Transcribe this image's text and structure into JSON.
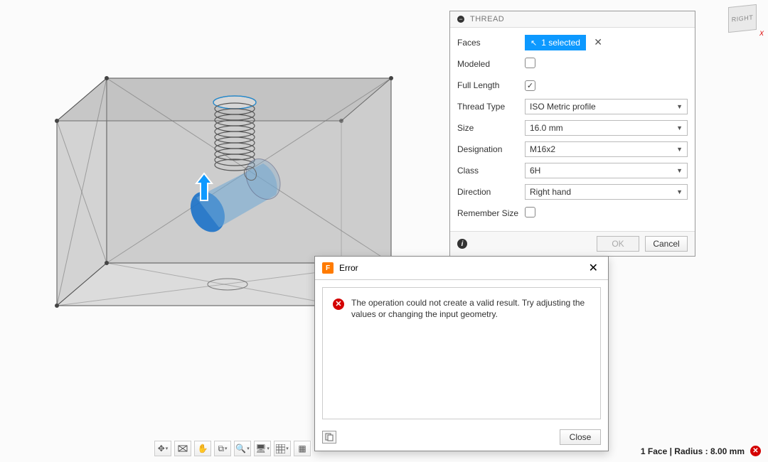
{
  "thread_panel": {
    "title": "THREAD",
    "rows": {
      "faces": {
        "label": "Faces",
        "chip_text": "1 selected"
      },
      "modeled": {
        "label": "Modeled",
        "checked": false
      },
      "full_length": {
        "label": "Full Length",
        "checked": true
      },
      "thread_type": {
        "label": "Thread Type",
        "value": "ISO Metric profile"
      },
      "size": {
        "label": "Size",
        "value": "16.0 mm"
      },
      "designation": {
        "label": "Designation",
        "value": "M16x2"
      },
      "class": {
        "label": "Class",
        "value": "6H"
      },
      "direction": {
        "label": "Direction",
        "value": "Right hand"
      },
      "remember": {
        "label": "Remember Size",
        "checked": false
      }
    },
    "buttons": {
      "ok": "OK",
      "cancel": "Cancel"
    }
  },
  "error_dialog": {
    "title": "Error",
    "message": "The operation could not create a valid result. Try adjusting the values or changing the input geometry.",
    "close_label": "Close"
  },
  "viewcube": {
    "face": "RIGHT"
  },
  "status": {
    "text": "1 Face | Radius : 8.00 mm"
  },
  "toolbar_icons": {
    "orbit": "orbit-icon",
    "look": "look-icon",
    "pan": "pan-icon",
    "zoom_window": "zoom-window-icon",
    "zoom": "zoom-icon",
    "display": "display-icon",
    "grid": "grid-icon",
    "snap": "snap-icon"
  }
}
